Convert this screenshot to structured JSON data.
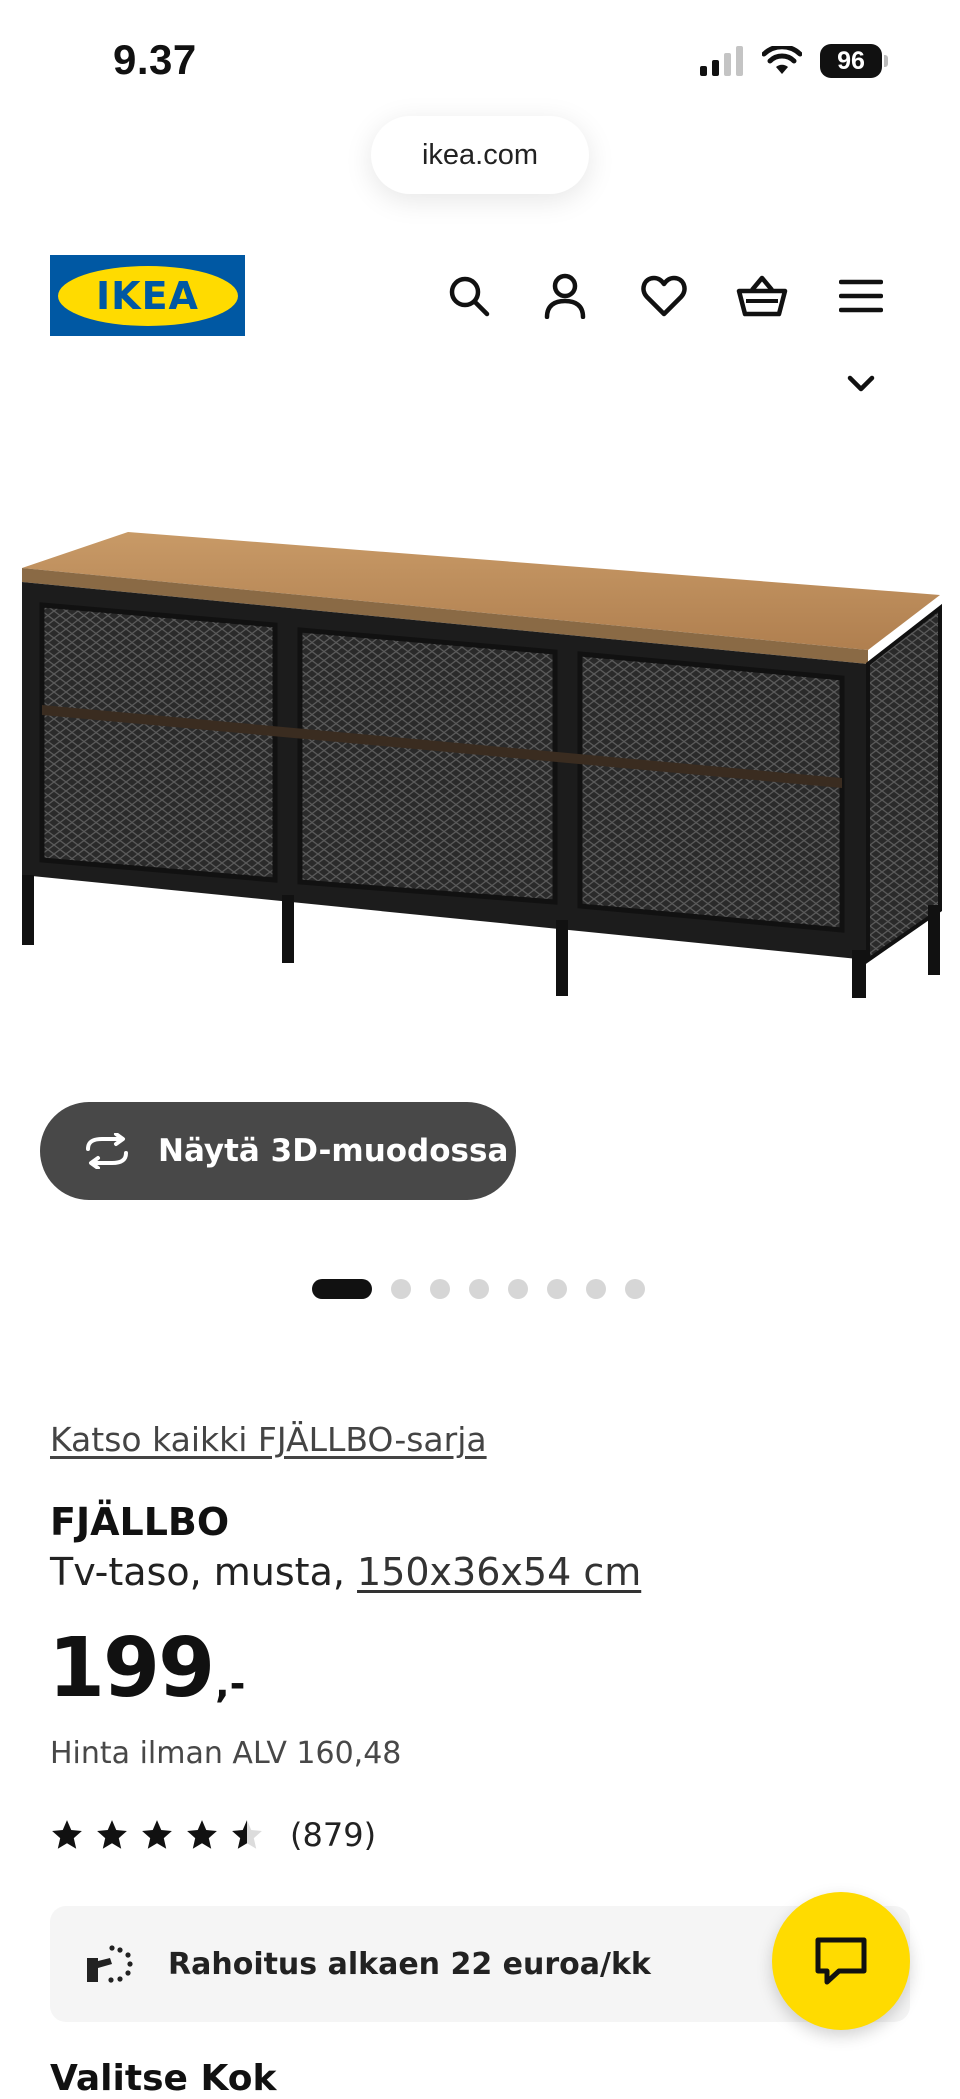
{
  "status_bar": {
    "time": "9.37",
    "battery": "96"
  },
  "browser": {
    "url": "ikea.com"
  },
  "header": {
    "logo_text": "IKEA",
    "icons": [
      "search-icon",
      "account-icon",
      "heart-icon",
      "cart-icon",
      "menu-icon"
    ]
  },
  "gallery": {
    "view_3d_label": "Näytä 3D-muodossa",
    "slide_count": 8,
    "active_slide": 1
  },
  "product": {
    "series_link": "Katso kaikki FJÄLLBO-sarja",
    "name": "FJÄLLBO",
    "description_prefix": "Tv-taso, musta, ",
    "dimensions": "150x36x54 cm",
    "price_main": "199",
    "price_suffix": ",-",
    "vat_text": "Hinta ilman ALV 160,48",
    "rating": 4.5,
    "review_count": "(879)"
  },
  "financing": {
    "text": "Rahoitus alkaen 22 euroa/kk"
  },
  "next_section_partial": "Valitse Kok",
  "colors": {
    "ikea_blue": "#0058a3",
    "ikea_yellow": "#ffdb00",
    "button_dark": "#484848"
  }
}
